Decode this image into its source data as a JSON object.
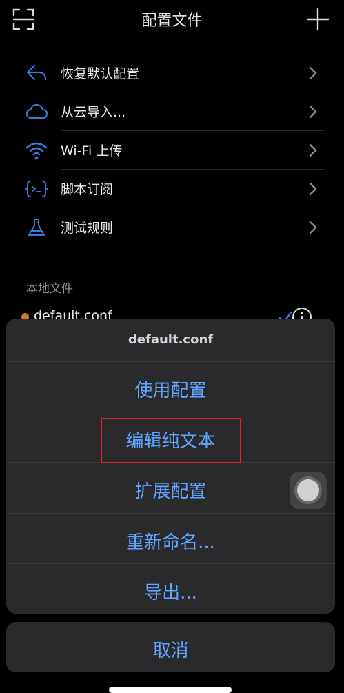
{
  "navbar": {
    "title": "配置文件"
  },
  "menu": [
    {
      "label": "恢复默认配置",
      "icon": "undo-arrow-icon"
    },
    {
      "label": "从云导入...",
      "icon": "cloud-icon"
    },
    {
      "label": "Wi-Fi 上传",
      "icon": "wifi-icon"
    },
    {
      "label": "脚本订阅",
      "icon": "script-braces-icon"
    },
    {
      "label": "测试规则",
      "icon": "flask-icon"
    }
  ],
  "local_files": {
    "header": "本地文件",
    "items": [
      {
        "name": "default.conf",
        "status_color": "#c77a24"
      }
    ]
  },
  "action_sheet": {
    "title": "default.conf",
    "actions": [
      "使用配置",
      "编辑纯文本",
      "扩展配置",
      "重新命名...",
      "导出..."
    ],
    "cancel": "取消"
  },
  "colors": {
    "accent": "#5ea6ff",
    "highlight": "#e1212a",
    "background": "#000000",
    "sheet": "#2a2a2c"
  }
}
